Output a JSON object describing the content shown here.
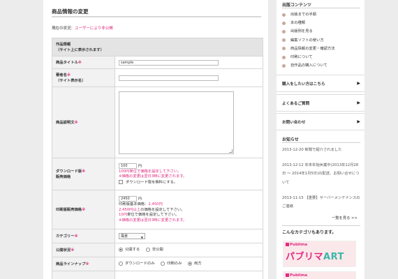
{
  "main": {
    "title": "商品情報の変更",
    "status_label": "現在の状況：",
    "status_value": "ユーザーにより非公開",
    "section_header_line1": "作品情報",
    "section_header_line2": "（サイト上に表示されます）",
    "required_mark": "※",
    "product_title_label": "商品タイトル",
    "product_title_value": "sample",
    "author_label": "著者名",
    "author_note": "（サイト表示名）",
    "author_value": "",
    "description_label": "商品説明文",
    "download_label_1": "ダウンロード版",
    "download_label_2": "販売価格",
    "download_price": "100",
    "yen": "円",
    "download_note1": "100円単位で価格を設定して下さい。",
    "download_note2": "※価格の変更は翌日3時に変更されます。",
    "download_free": "ダウンロード版を無料にする。",
    "print_label": "印刷版販売価格",
    "print_price": "2450",
    "print_base": "印刷版基本価格：",
    "print_base_value": "2,450円",
    "print_note1_pink": "2,450円以上",
    "print_note1_rest": "の価格を設定して下さい。",
    "print_note2_pink": "10円",
    "print_note2_rest": "単位で価格を設定して下さい。",
    "print_note3": "※価格の変更は翌日3時に変更されます。",
    "category_label": "カテゴリー",
    "category_value": "風景",
    "publish_label": "公開状況",
    "publish_options": [
      "公開する",
      "非公開"
    ],
    "publish_selected": 0,
    "lineup_label": "商品ラインナップ",
    "lineup_options": [
      "ダウンロードのみ",
      "印刷のみ",
      "両方"
    ],
    "lineup_selected": 2
  },
  "sidebar": {
    "contents_head": "出版コンテンツ",
    "contents_items": [
      "出版までの手順",
      "本の種類",
      "出版例を見る",
      "編集ソフトの使い方",
      "商品情報の変更・確認方法",
      "印刷について",
      "自作品の購入について"
    ],
    "buttons": [
      "購入をしたい方はこちら",
      "よくあるご質問",
      "お問い合わせ"
    ],
    "news_head": "お知らせ",
    "news": [
      "2013-12-20 新聞で紹介されました",
      "2013-12-12 年末年始休業中(2013年12月28日 ～ 2014年1月5日)の配送、お問い合せについて",
      "2013-11-15 【重要】サーバーメンテナンスのご連絡"
    ],
    "news_more": "一覧を見る >>",
    "categories_head": "こんなカテゴリもあります。",
    "banner_logo": "Publima",
    "banner_text_a": "パブリマ",
    "banner_text_b": "ART",
    "accent_color": "#e0297f"
  }
}
